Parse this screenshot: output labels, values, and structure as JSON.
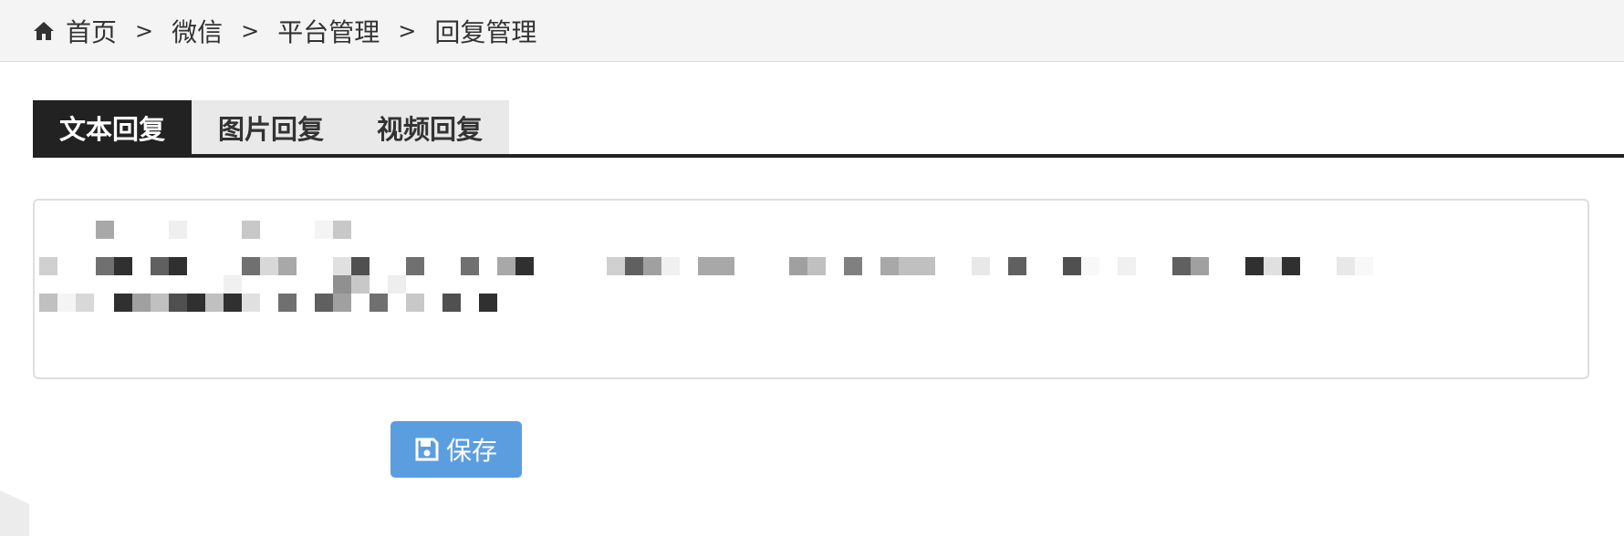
{
  "breadcrumb": {
    "icon": "home-icon",
    "items": [
      "首页",
      "微信",
      "平台管理",
      "回复管理"
    ],
    "separator": ">"
  },
  "tabs": [
    {
      "label": "文本回复",
      "active": true
    },
    {
      "label": "图片回复",
      "active": false
    },
    {
      "label": "视频回复",
      "active": false
    }
  ],
  "reply_textarea": {
    "content_state": "pixelated / obscured text"
  },
  "save_button": {
    "label": "保存",
    "icon": "floppy-disk-icon",
    "color": "#5b9ee0"
  },
  "colors": {
    "active_tab": "#222222",
    "inactive_tab": "#e9e9e9",
    "breadcrumb_bg": "#f4f4f4"
  }
}
